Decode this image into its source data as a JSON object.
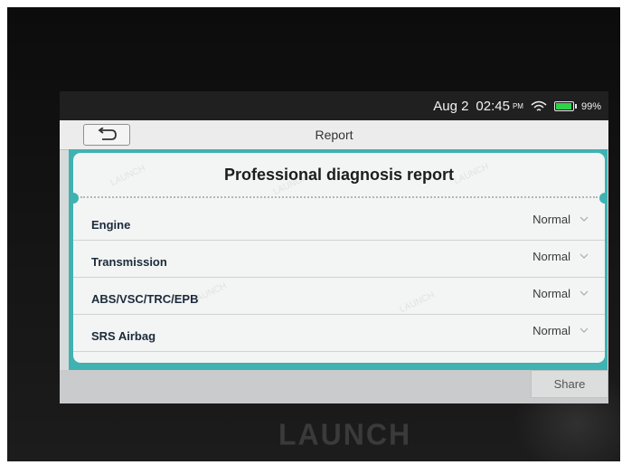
{
  "status_bar": {
    "date": "Aug 2",
    "time": "02:45",
    "ampm": "PM",
    "battery_percent": "99%",
    "battery_color": "#2fd24a",
    "wifi_icon": "wifi-icon",
    "battery_icon": "battery-icon"
  },
  "titlebar": {
    "title": "Report",
    "back_icon": "back-arrow-icon"
  },
  "report": {
    "heading": "Professional diagnosis report",
    "rows": [
      {
        "name": "Engine",
        "status": "Normal"
      },
      {
        "name": "Transmission",
        "status": "Normal"
      },
      {
        "name": "ABS/VSC/TRC/EPB",
        "status": "Normal"
      },
      {
        "name": "SRS Airbag",
        "status": "Normal"
      }
    ],
    "accent_color": "#40b2b2"
  },
  "footer": {
    "share_label": "Share"
  },
  "device": {
    "brand": "LAUNCH"
  }
}
